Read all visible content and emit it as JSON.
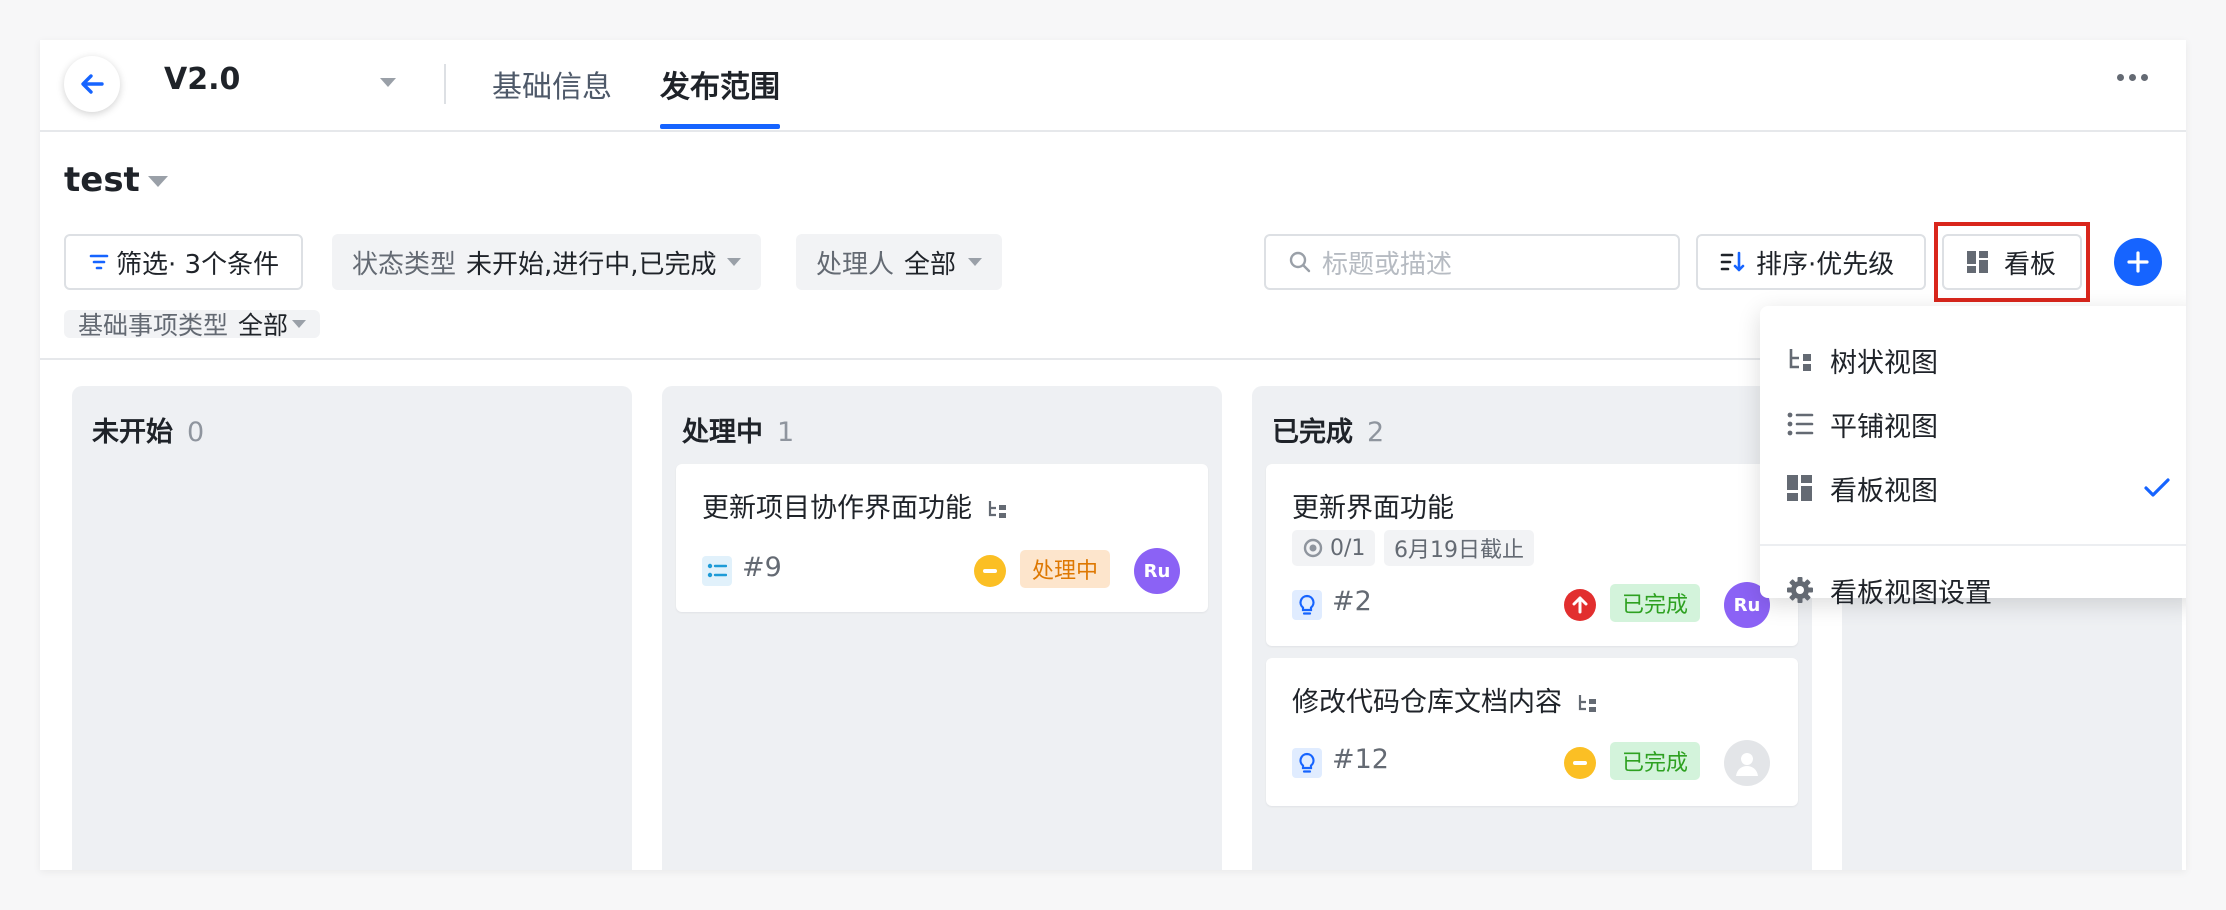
{
  "header": {
    "version": "V2.0",
    "tabs": [
      {
        "label": "基础信息",
        "active": false
      },
      {
        "label": "发布范围",
        "active": true
      }
    ]
  },
  "board": {
    "title": "test"
  },
  "filters": {
    "filter_button": "筛选· 3个条件",
    "status_type_key": "状态类型",
    "status_type_value": "未开始,进行中,已完成",
    "assignee_key": "处理人",
    "assignee_value": "全部",
    "item_type_key": "基础事项类型",
    "item_type_value": "全部"
  },
  "toolbar": {
    "search_placeholder": "标题或描述",
    "sort_label": "排序·优先级",
    "view_label": "看板"
  },
  "columns": [
    {
      "title": "未开始",
      "count": "0",
      "cards": []
    },
    {
      "title": "处理中",
      "count": "1",
      "cards": [
        {
          "title": "更新项目协作界面功能",
          "number": "#9",
          "status": "处理中",
          "priority": "medium",
          "assignee": "Ru"
        }
      ]
    },
    {
      "title": "已完成",
      "count": "2",
      "cards": [
        {
          "title": "更新界面功能",
          "progress": "0/1",
          "due": "6月19日截止",
          "number": "#2",
          "status": "已完成",
          "priority": "high",
          "assignee": "Ru"
        },
        {
          "title": "修改代码仓库文档内容",
          "number": "#12",
          "status": "已完成",
          "priority": "medium",
          "assignee": ""
        }
      ]
    }
  ],
  "view_menu": {
    "items": [
      {
        "label": "树状视图",
        "icon": "tree-view-icon",
        "selected": false
      },
      {
        "label": "平铺视图",
        "icon": "list-view-icon",
        "selected": false
      },
      {
        "label": "看板视图",
        "icon": "kanban-view-icon",
        "selected": true
      }
    ],
    "settings_label": "看板视图设置"
  },
  "colors": {
    "accent": "#1664ff",
    "highlight_box": "#d9261c",
    "status_in_progress": "#de7802",
    "status_done": "#2ea121",
    "avatar": "#8b62f5"
  }
}
